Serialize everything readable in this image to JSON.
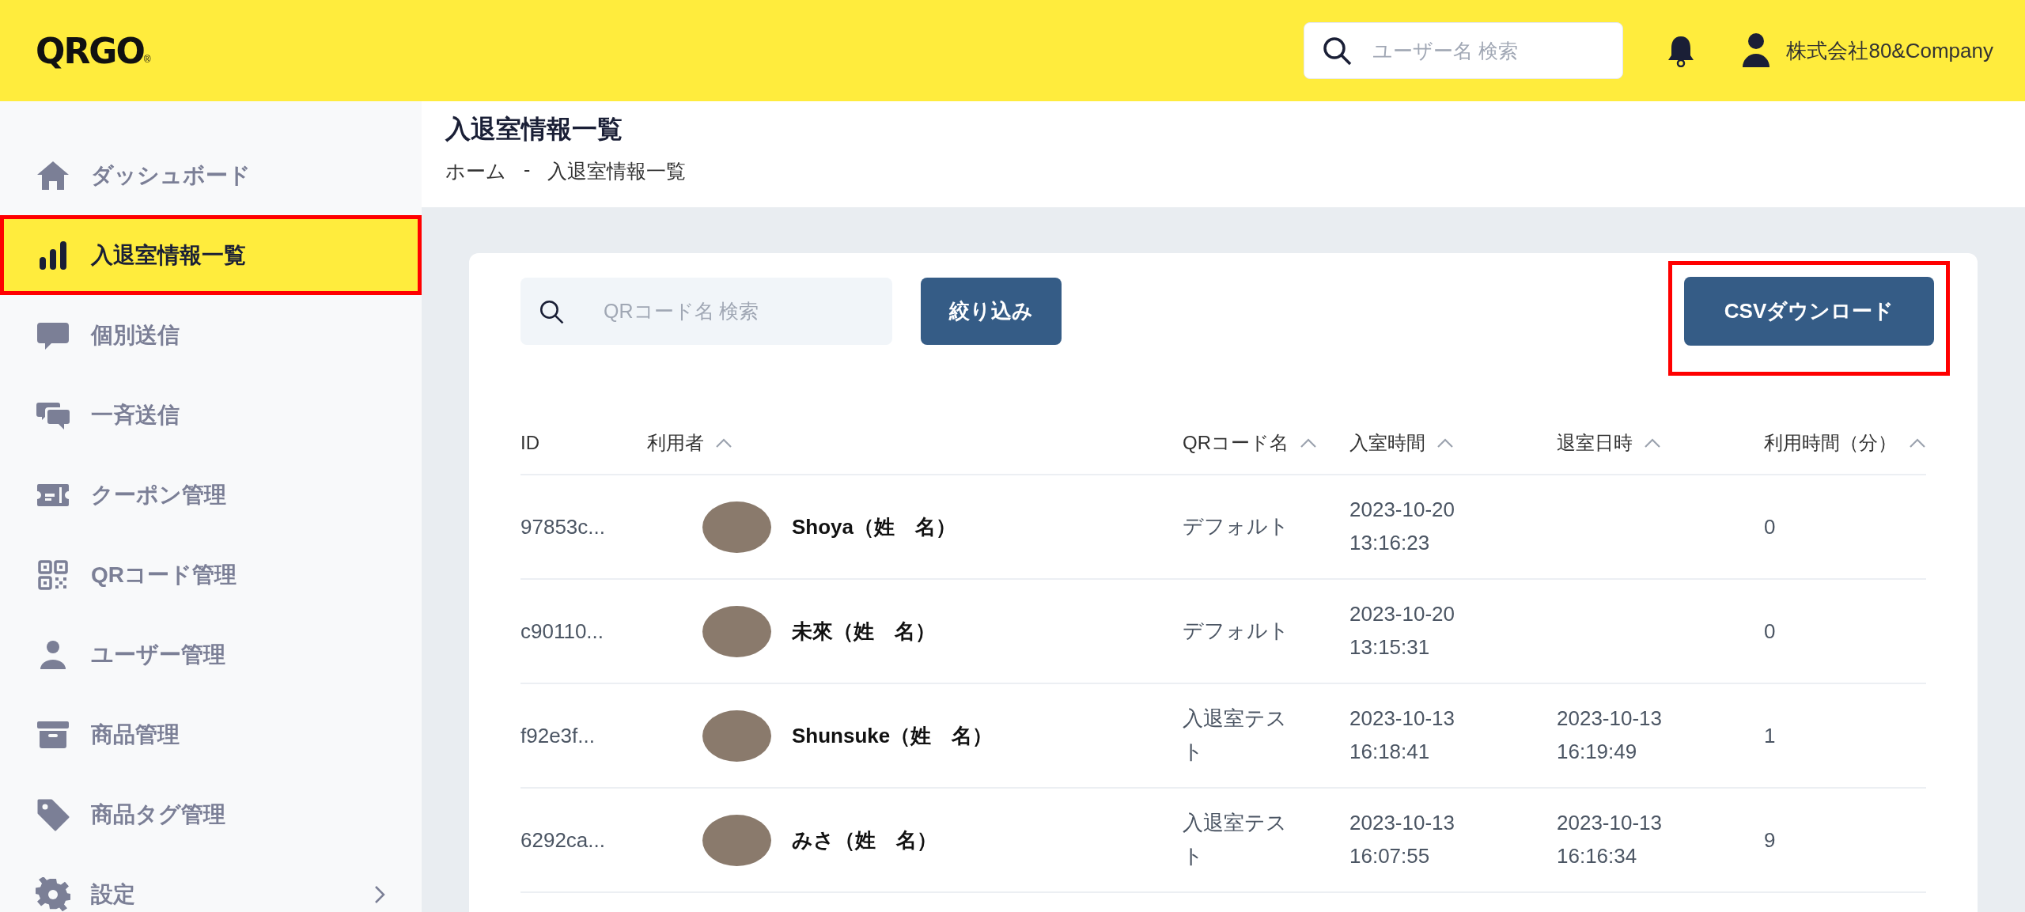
{
  "header": {
    "logo": "QRGO",
    "logo_mark": "®",
    "search": {
      "placeholder": "ユーザー名 検索"
    },
    "account": "株式会社80&Company"
  },
  "sidebar": {
    "items": [
      {
        "label": "ダッシュボード",
        "kind": "home",
        "selected": false,
        "annotated": false,
        "expandable": false
      },
      {
        "label": "入退室情報一覧",
        "kind": "chart",
        "selected": true,
        "annotated": true,
        "expandable": false
      },
      {
        "label": "個別送信",
        "kind": "chat",
        "selected": false,
        "annotated": false,
        "expandable": false
      },
      {
        "label": "一斉送信",
        "kind": "chats",
        "selected": false,
        "annotated": false,
        "expandable": false
      },
      {
        "label": "クーポン管理",
        "kind": "ticket",
        "selected": false,
        "annotated": false,
        "expandable": false
      },
      {
        "label": "QRコード管理",
        "kind": "qr",
        "selected": false,
        "annotated": false,
        "expandable": false
      },
      {
        "label": "ユーザー管理",
        "kind": "user",
        "selected": false,
        "annotated": false,
        "expandable": false
      },
      {
        "label": "商品管理",
        "kind": "box",
        "selected": false,
        "annotated": false,
        "expandable": false
      },
      {
        "label": "商品タグ管理",
        "kind": "tag",
        "selected": false,
        "annotated": false,
        "expandable": false
      },
      {
        "label": "設定",
        "kind": "gear",
        "selected": false,
        "annotated": false,
        "expandable": true
      }
    ]
  },
  "page": {
    "title": "入退室情報一覧",
    "breadcrumb": [
      "ホーム",
      "入退室情報一覧"
    ],
    "breadcrumb_separator": "-"
  },
  "toolbar": {
    "search": {
      "placeholder": "QRコード名 検索"
    },
    "filter_button": "絞り込み",
    "csv_button": {
      "label": "CSVダウンロード",
      "annotated": true
    }
  },
  "table": {
    "columns": [
      {
        "label": "ID",
        "sortable": false
      },
      {
        "label": "利用者",
        "sortable": true
      },
      {
        "label": "QRコード名",
        "sortable": true
      },
      {
        "label": "入室時間",
        "sortable": true
      },
      {
        "label": "退室日時",
        "sortable": true
      },
      {
        "label": "利用時間（分）",
        "sortable": true
      }
    ],
    "rows": [
      {
        "id": "97853c...",
        "user": "Shoya（姓　名）",
        "qr_code": "デフォルト",
        "entered": [
          "2023-10-20",
          "13:16:23"
        ],
        "exited": [],
        "minutes": "0"
      },
      {
        "id": "c90110...",
        "user": "未來（姓　名）",
        "qr_code": "デフォルト",
        "entered": [
          "2023-10-20",
          "13:15:31"
        ],
        "exited": [],
        "minutes": "0"
      },
      {
        "id": "f92e3f...",
        "user": "Shunsuke（姓　名）",
        "qr_code": "入退室テスト",
        "entered": [
          "2023-10-13",
          "16:18:41"
        ],
        "exited": [
          "2023-10-13",
          "16:19:49"
        ],
        "minutes": "1"
      },
      {
        "id": "6292ca...",
        "user": "みさ（姓　名）",
        "qr_code": "入退室テスト",
        "entered": [
          "2023-10-13",
          "16:07:55"
        ],
        "exited": [
          "2023-10-13",
          "16:16:34"
        ],
        "minutes": "9"
      }
    ]
  }
}
